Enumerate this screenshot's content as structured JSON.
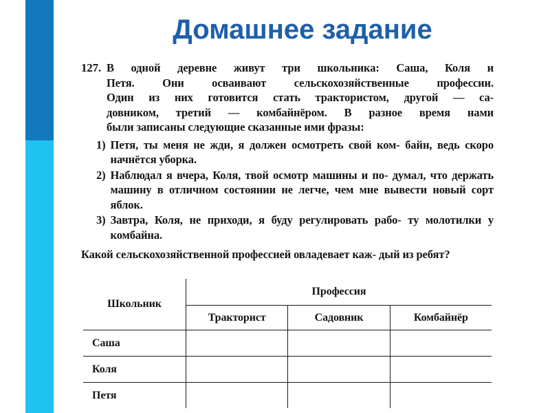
{
  "slide": {
    "title": "Домашнее задание",
    "title_color": "#1f5fa9",
    "accent_color_top": "#1378bd",
    "accent_color_bottom": "#1ec3f0"
  },
  "problem": {
    "number": "127.",
    "intro_lines": [
      "В одной деревне живут три школьника: Саша, Коля и",
      "Петя. Они осваивают сельскохозяйственные профессии.",
      "Один из них готовится стать трактористом, другой — са-",
      "довником, третий — комбайнёром. В разное время нами",
      "были записаны следующие сказанные ими фразы:"
    ],
    "statements": [
      {
        "marker": "1)",
        "text": "Петя, ты меня не жди, я должен осмотреть свой ком- байн, ведь скоро начнётся уборка."
      },
      {
        "marker": "2)",
        "text": "Наблюдал я вчера, Коля, твой осмотр машины и по- думал, что держать машину в отличном состоянии не легче, чем мне вывести новый сорт яблок."
      },
      {
        "marker": "3)",
        "text": "Завтра, Коля, не приходи, я буду регулировать рабо- ту молотилки у комбайна."
      }
    ],
    "question": "Какой сельскохозяйственной профессией овладевает каж- дый из ребят?"
  },
  "answer_table": {
    "header_pupil": "Школьник",
    "header_group": "Профессия",
    "subheaders": [
      "Тракторист",
      "Садовник",
      "Комбайнёр"
    ],
    "rows": [
      {
        "name": "Саша",
        "cells": [
          "",
          "",
          ""
        ]
      },
      {
        "name": "Коля",
        "cells": [
          "",
          "",
          ""
        ]
      },
      {
        "name": "Петя",
        "cells": [
          "",
          "",
          ""
        ]
      }
    ]
  }
}
